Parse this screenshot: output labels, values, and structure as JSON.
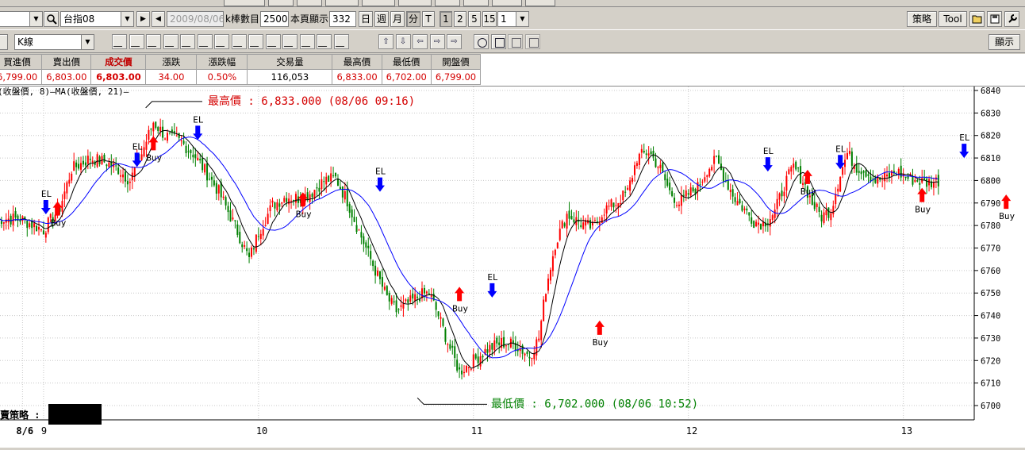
{
  "toolbar1": {
    "symbol": "台指08",
    "date": "2009/08/06",
    "bar_count_label": "k棒數目",
    "bar_count": "2500",
    "page_display_label": "本頁顯示",
    "page_display": "332",
    "periods": [
      "日",
      "週",
      "月",
      "分",
      "T"
    ],
    "minutes": [
      "1",
      "2",
      "5",
      "15"
    ],
    "minute_select": "1",
    "strategy_label": "策略",
    "tool_label": "Tool"
  },
  "toolbar2": {
    "chart_type": "K線",
    "display_label": "顯示"
  },
  "quote": {
    "headers": [
      "買進價",
      "賣出價",
      "成交價",
      "漲跌",
      "漲跌幅",
      "交易量",
      "最高價",
      "最低價",
      "開盤價"
    ],
    "values": [
      "6,799.00",
      "6,803.00",
      "6,803.00",
      "34.00",
      "0.50%",
      "116,053",
      "6,833.00",
      "6,702.00",
      "6,799.00"
    ]
  },
  "chart": {
    "legend": "(收盤價, 8)—MA(收盤價, 21)—",
    "high_note": "最高價 : 6,833.000 (08/06 09:16)",
    "low_note": "最低價 : 6,702.000 (08/06 10:52)",
    "strategy_label": "買賣策略 :",
    "x_labels": [
      "8/6",
      "9",
      "10",
      "11",
      "12",
      "13"
    ],
    "y_ticks": [
      6840,
      6830,
      6820,
      6810,
      6800,
      6790,
      6780,
      6770,
      6760,
      6750,
      6740,
      6730,
      6720,
      6710,
      6700
    ],
    "signal_labels": {
      "buy": "Buy",
      "exit": "EL"
    },
    "colors": {
      "up": "#ff0000",
      "down": "#008000",
      "ma_short": "#000000",
      "ma_long": "#0000ff",
      "buy_arrow": "#ff0000",
      "exit_arrow": "#0000ff",
      "high_note": "#d40000",
      "low_note": "#008000"
    }
  },
  "chart_data": {
    "type": "candlestick",
    "title": "台指08",
    "ylim": [
      6695,
      6843
    ],
    "anchors": [
      [
        0,
        6783
      ],
      [
        10,
        6783
      ],
      [
        20,
        6778
      ],
      [
        27,
        6788
      ],
      [
        32,
        6805
      ],
      [
        40,
        6810
      ],
      [
        47,
        6808
      ],
      [
        52,
        6805
      ],
      [
        57,
        6800
      ],
      [
        62,
        6812
      ],
      [
        67,
        6826
      ],
      [
        72,
        6820
      ],
      [
        79,
        6817
      ],
      [
        84,
        6812
      ],
      [
        90,
        6803
      ],
      [
        95,
        6795
      ],
      [
        100,
        6784
      ],
      [
        104,
        6775
      ],
      [
        108,
        6765
      ],
      [
        112,
        6777
      ],
      [
        118,
        6789
      ],
      [
        124,
        6793
      ],
      [
        130,
        6792
      ],
      [
        135,
        6795
      ],
      [
        140,
        6800
      ],
      [
        145,
        6801
      ],
      [
        150,
        6791
      ],
      [
        154,
        6780
      ],
      [
        158,
        6770
      ],
      [
        162,
        6760
      ],
      [
        167,
        6748
      ],
      [
        171,
        6742
      ],
      [
        177,
        6746
      ],
      [
        181,
        6749
      ],
      [
        185,
        6750
      ],
      [
        189,
        6740
      ],
      [
        193,
        6728
      ],
      [
        198,
        6715
      ],
      [
        204,
        6720
      ],
      [
        210,
        6725
      ],
      [
        216,
        6728
      ],
      [
        222,
        6727
      ],
      [
        228,
        6722
      ],
      [
        232,
        6730
      ],
      [
        235,
        6752
      ],
      [
        239,
        6772
      ],
      [
        244,
        6785
      ],
      [
        250,
        6781
      ],
      [
        255,
        6779
      ],
      [
        260,
        6787
      ],
      [
        265,
        6790
      ],
      [
        270,
        6795
      ],
      [
        274,
        6810
      ],
      [
        279,
        6813
      ],
      [
        284,
        6805
      ],
      [
        288,
        6795
      ],
      [
        292,
        6790
      ],
      [
        296,
        6794
      ],
      [
        300,
        6797
      ],
      [
        304,
        6805
      ],
      [
        308,
        6809
      ],
      [
        312,
        6800
      ],
      [
        316,
        6792
      ],
      [
        320,
        6787
      ],
      [
        324,
        6782
      ],
      [
        328,
        6781
      ],
      [
        333,
        6786
      ],
      [
        337,
        6798
      ],
      [
        341,
        6806
      ],
      [
        345,
        6800
      ],
      [
        349,
        6790
      ],
      [
        353,
        6784
      ],
      [
        357,
        6787
      ],
      [
        361,
        6803
      ],
      [
        364,
        6812
      ],
      [
        368,
        6806
      ],
      [
        372,
        6804
      ],
      [
        376,
        6800
      ],
      [
        380,
        6801
      ],
      [
        385,
        6804
      ],
      [
        390,
        6801
      ],
      [
        394,
        6800
      ],
      [
        398,
        6799
      ],
      [
        403,
        6800
      ]
    ],
    "sessions": [
      {
        "label": "8/6",
        "bar": 11
      },
      {
        "label": "9",
        "bar": 20
      },
      {
        "label": "10",
        "bar": 112
      },
      {
        "label": "11",
        "bar": 204
      },
      {
        "label": "12",
        "bar": 296
      },
      {
        "label": "13",
        "bar": 388
      }
    ],
    "signals": [
      {
        "type": "exit",
        "bar": 21,
        "price": 6785
      },
      {
        "type": "buy",
        "bar": 26,
        "price": 6783
      },
      {
        "type": "exit",
        "bar": 60,
        "price": 6806
      },
      {
        "type": "buy",
        "bar": 67,
        "price": 6812
      },
      {
        "type": "exit",
        "bar": 86,
        "price": 6818
      },
      {
        "type": "buy",
        "bar": 131,
        "price": 6787
      },
      {
        "type": "exit",
        "bar": 164,
        "price": 6795
      },
      {
        "type": "buy",
        "bar": 198,
        "price": 6745
      },
      {
        "type": "exit",
        "bar": 212,
        "price": 6748
      },
      {
        "type": "buy",
        "bar": 258,
        "price": 6730
      },
      {
        "type": "exit",
        "bar": 330,
        "price": 6804
      },
      {
        "type": "buy",
        "bar": 347,
        "price": 6797
      },
      {
        "type": "exit",
        "bar": 361,
        "price": 6805
      },
      {
        "type": "buy",
        "bar": 396,
        "price": 6789
      },
      {
        "type": "exit",
        "bar": 414,
        "price": 6810
      },
      {
        "type": "buy",
        "bar": 432,
        "price": 6786
      }
    ],
    "high": {
      "price": 6833,
      "time": "08/06 09:16"
    },
    "low": {
      "price": 6702,
      "time": "08/06 10:52"
    }
  }
}
